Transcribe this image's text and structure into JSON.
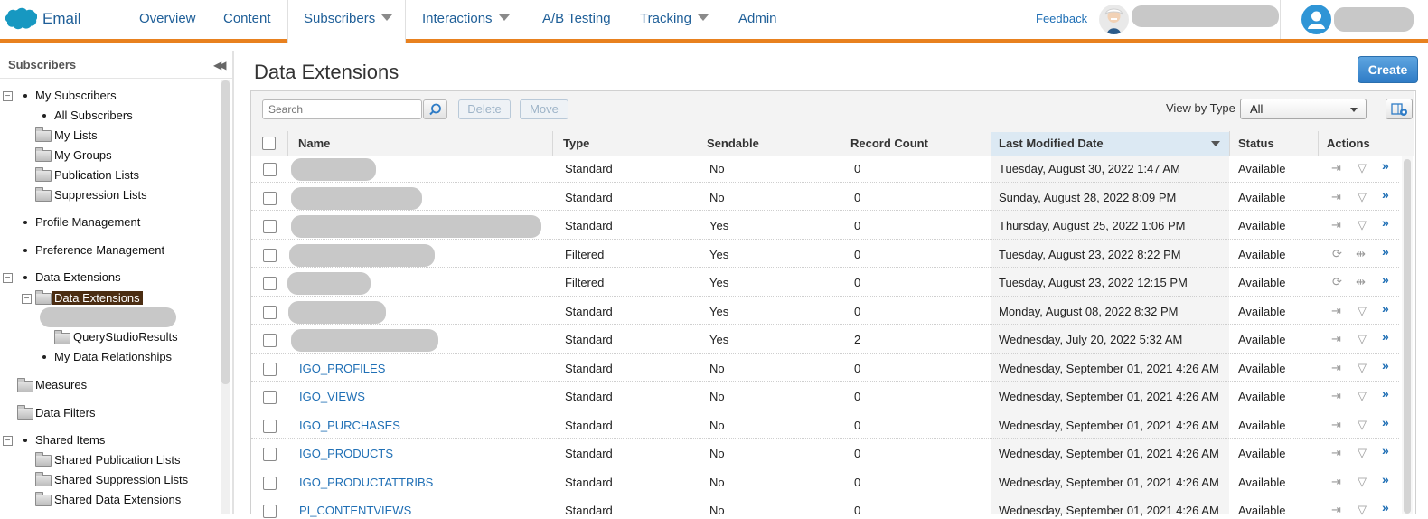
{
  "nav": {
    "app_name": "Email",
    "items": [
      "Overview",
      "Content",
      "Subscribers",
      "Interactions",
      "A/B Testing",
      "Tracking",
      "Admin"
    ],
    "active_item": "Subscribers",
    "feedback": "Feedback",
    "brand_color": "#e8811f",
    "link_color": "#1f5f98"
  },
  "sidebar": {
    "title": "Subscribers",
    "tree": {
      "my_subscribers": "My Subscribers",
      "all_subscribers": "All Subscribers",
      "my_lists": "My Lists",
      "my_groups": "My Groups",
      "publication_lists": "Publication Lists",
      "suppression_lists": "Suppression Lists",
      "profile_management": "Profile Management",
      "preference_management": "Preference Management",
      "data_extensions_root": "Data Extensions",
      "data_extensions_folder": "Data Extensions",
      "query_studio_results": "QueryStudioResults",
      "my_data_relationships": "My Data Relationships",
      "measures": "Measures",
      "data_filters": "Data Filters",
      "shared_items": "Shared Items",
      "shared_publication_lists": "Shared Publication Lists",
      "shared_suppression_lists": "Shared Suppression Lists",
      "shared_data_extensions": "Shared Data Extensions"
    }
  },
  "main": {
    "title": "Data Extensions",
    "create_label": "Create",
    "search_placeholder": "Search",
    "delete_label": "Delete",
    "move_label": "Move",
    "view_by_type_label": "View by Type",
    "view_by_type_value": "All",
    "columns": [
      "Name",
      "Type",
      "Sendable",
      "Record Count",
      "Last Modified Date",
      "Status",
      "Actions"
    ],
    "rows": [
      {
        "name": "",
        "type": "Standard",
        "sendable": "No",
        "count": "0",
        "modified": "Tuesday, August 30, 2022 1:47 AM",
        "status": "Available",
        "kind": "standard"
      },
      {
        "name": "",
        "type": "Standard",
        "sendable": "No",
        "count": "0",
        "modified": "Sunday, August 28, 2022 8:09 PM",
        "status": "Available",
        "kind": "standard"
      },
      {
        "name": "",
        "type": "Standard",
        "sendable": "Yes",
        "count": "0",
        "modified": "Thursday, August 25, 2022 1:06 PM",
        "status": "Available",
        "kind": "standard"
      },
      {
        "name": "",
        "type": "Filtered",
        "sendable": "Yes",
        "count": "0",
        "modified": "Tuesday, August 23, 2022 8:22 PM",
        "status": "Available",
        "kind": "filtered"
      },
      {
        "name": "",
        "type": "Filtered",
        "sendable": "Yes",
        "count": "0",
        "modified": "Tuesday, August 23, 2022 12:15 PM",
        "status": "Available",
        "kind": "filtered"
      },
      {
        "name": "",
        "type": "Standard",
        "sendable": "Yes",
        "count": "0",
        "modified": "Monday, August 08, 2022 8:32 PM",
        "status": "Available",
        "kind": "standard"
      },
      {
        "name": "",
        "type": "Standard",
        "sendable": "Yes",
        "count": "2",
        "modified": "Wednesday, July 20, 2022 5:32 AM",
        "status": "Available",
        "kind": "standard"
      },
      {
        "name": "IGO_PROFILES",
        "type": "Standard",
        "sendable": "No",
        "count": "0",
        "modified": "Wednesday, September 01, 2021 4:26 AM",
        "status": "Available",
        "kind": "standard"
      },
      {
        "name": "IGO_VIEWS",
        "type": "Standard",
        "sendable": "No",
        "count": "0",
        "modified": "Wednesday, September 01, 2021 4:26 AM",
        "status": "Available",
        "kind": "standard"
      },
      {
        "name": "IGO_PURCHASES",
        "type": "Standard",
        "sendable": "No",
        "count": "0",
        "modified": "Wednesday, September 01, 2021 4:26 AM",
        "status": "Available",
        "kind": "standard"
      },
      {
        "name": "IGO_PRODUCTS",
        "type": "Standard",
        "sendable": "No",
        "count": "0",
        "modified": "Wednesday, September 01, 2021 4:26 AM",
        "status": "Available",
        "kind": "standard"
      },
      {
        "name": "IGO_PRODUCTATTRIBS",
        "type": "Standard",
        "sendable": "No",
        "count": "0",
        "modified": "Wednesday, September 01, 2021 4:26 AM",
        "status": "Available",
        "kind": "standard"
      },
      {
        "name": "PI_CONTENTVIEWS",
        "type": "Standard",
        "sendable": "No",
        "count": "0",
        "modified": "Wednesday, September 01, 2021 4:26 AM",
        "status": "Available",
        "kind": "standard"
      }
    ]
  }
}
